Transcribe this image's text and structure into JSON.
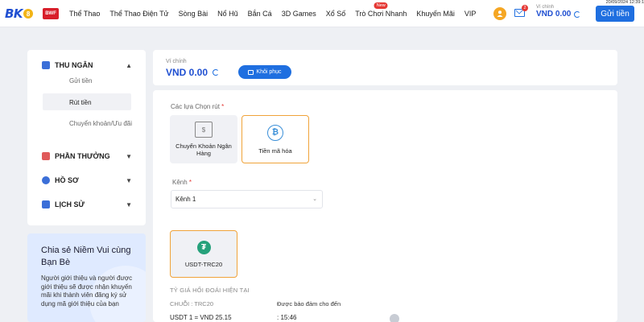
{
  "header": {
    "logo_text": "BK",
    "logo_coin": "8",
    "partner_logo": "BWF",
    "nav": [
      {
        "label": "Thể Thao"
      },
      {
        "label": "Thể Thao Điện Tử"
      },
      {
        "label": "Sòng Bài"
      },
      {
        "label": "Nổ Hũ"
      },
      {
        "label": "Bắn Cá"
      },
      {
        "label": "3D Games"
      },
      {
        "label": "Xổ Số"
      },
      {
        "label": "Trò Chơi Nhanh",
        "badge": "New"
      },
      {
        "label": "Khuyến Mãi"
      },
      {
        "label": "VIP"
      }
    ],
    "mail_count": "2",
    "wallet_label": "Ví chính",
    "wallet_amount": "VND 0.00",
    "deposit_label": "Gửi tiền",
    "datetime": "20/09/2024 12:39:1"
  },
  "sidebar": {
    "sections": [
      {
        "label": "THU NGÂN",
        "icon": "cashier-icon",
        "expanded": true
      },
      {
        "label": "PHẦN THƯỞNG",
        "icon": "gift-icon"
      },
      {
        "label": "HỒ SƠ",
        "icon": "user-icon"
      },
      {
        "label": "LỊCH SỬ",
        "icon": "history-icon"
      }
    ],
    "sub_items": [
      "Gửi tiền",
      "Rút tiền",
      "Chuyển khoản/Ưu đãi"
    ],
    "active_sub": "Rút tiền"
  },
  "share": {
    "title": "Chia sẻ Niềm Vui cùng Bạn Bè",
    "text": "Người giới thiệu và người được giới thiệu sẽ được nhận khuyến mãi khi thành viên đăng ký sử dụng mã giới thiệu của bạn"
  },
  "wallet": {
    "label": "Ví chính",
    "amount": "VND 0.00",
    "restore_label": "Khôi phục"
  },
  "withdraw": {
    "options_label": "Các lựa Chọn rút",
    "required_mark": "*",
    "methods": [
      {
        "label": "Chuyển Khoản Ngân Hàng",
        "icon": "bank-icon",
        "selected": false
      },
      {
        "label": "Tiền mã hóa",
        "icon": "bitcoin-icon",
        "selected": true
      }
    ],
    "channel_label": "Kênh",
    "channel_value": "Kênh 1",
    "currency": {
      "label": "USDT-TRC20",
      "icon": "tether-icon"
    },
    "rate_title": "TỶ GIÁ HỐI ĐOÁI HIỆN TẠI",
    "chain": "CHUỖI : TRC20",
    "guarantee": "Được bảo đảm cho đến",
    "rate_value": "USDT 1 = VND 25.15",
    "rate_time": ": 15:46"
  },
  "colors": {
    "accent": "#1f6fe0",
    "brand": "#1f4fd1",
    "selected_border": "#f0a33a",
    "tether": "#26a17b"
  }
}
